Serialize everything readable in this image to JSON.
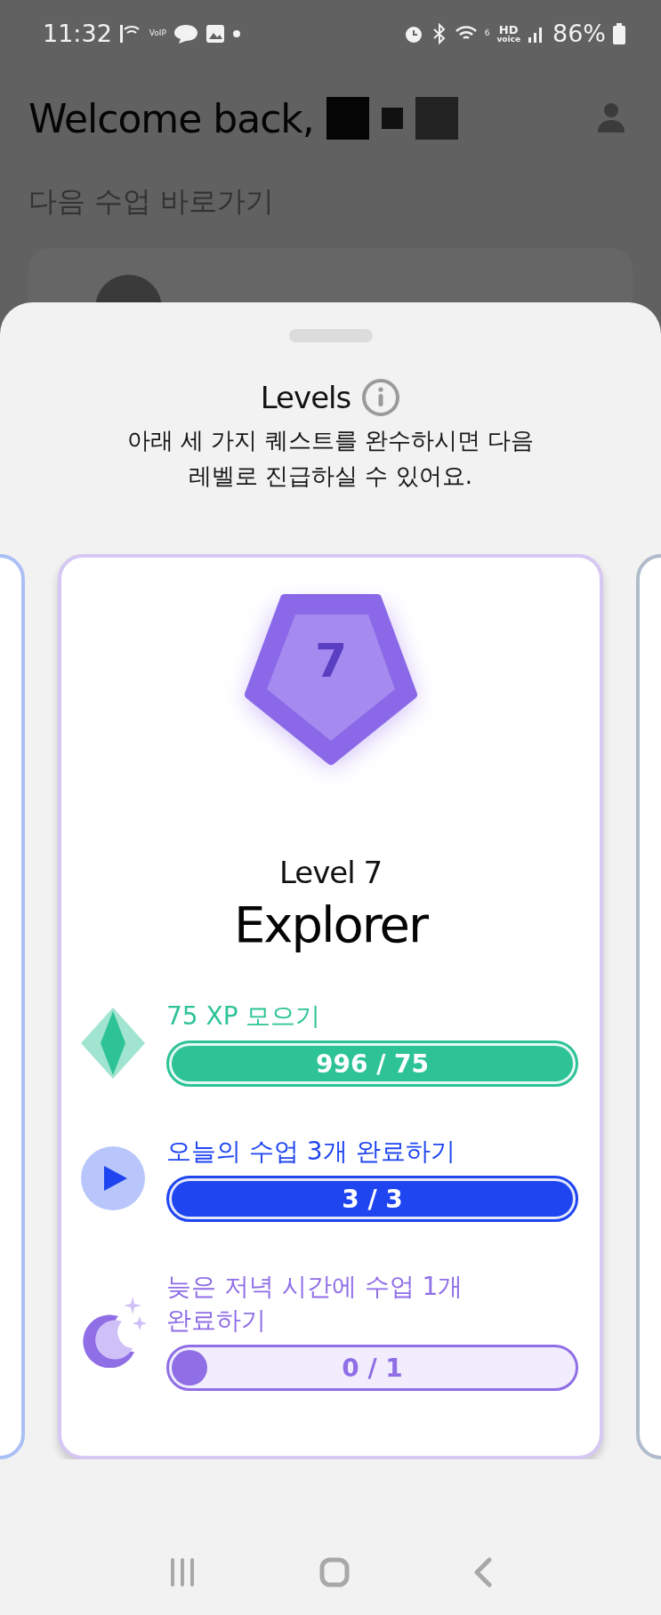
{
  "status_bar": {
    "time": "11:32",
    "voip_label": "VoIP",
    "hd_label": "HD",
    "hd_sublabel": "voice",
    "network_label": "6",
    "battery": "86%"
  },
  "header": {
    "greeting": "Welcome back,"
  },
  "next_lesson": {
    "title": "다음 수업 바로가기"
  },
  "sheet": {
    "title": "Levels",
    "subtitle": "아래 세 가지 퀘스트를 완수하시면 다음 레벨로 진급하실 수 있어요.",
    "level_card": {
      "badge_number": "7",
      "level_label": "Level 7",
      "level_name": "Explorer",
      "quests": [
        {
          "kind": "xp",
          "label": "75 XP 모으기",
          "reading": "996 / 75",
          "level": 1,
          "color": "#2ec397"
        },
        {
          "kind": "lesson",
          "label": "오늘의 수업 3개 완료하기",
          "reading": "3 / 3",
          "level": 1,
          "color": "#1f45f0"
        },
        {
          "kind": "night",
          "label": "늦은 저녁 시간에 수업 1개 완료하기",
          "reading": "0 / 1",
          "level": 0,
          "color": "#8f6ee6"
        }
      ]
    }
  }
}
